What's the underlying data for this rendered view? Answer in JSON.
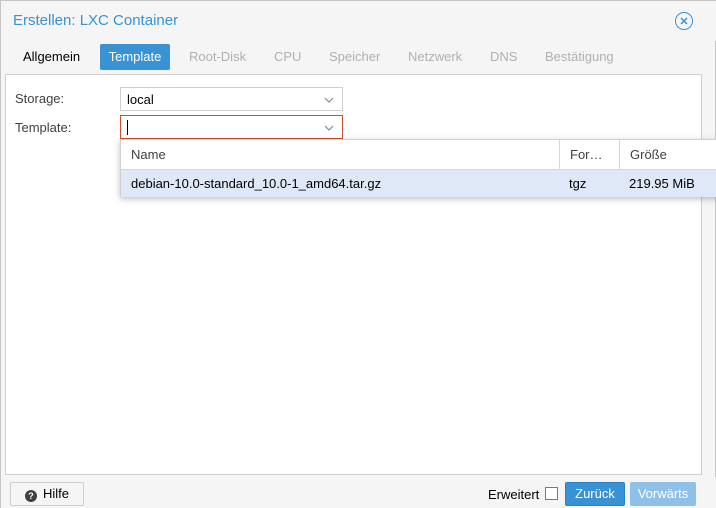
{
  "window": {
    "title": "Erstellen: LXC Container"
  },
  "tabs": [
    {
      "label": "Allgemein",
      "state": "done"
    },
    {
      "label": "Template",
      "state": "active"
    },
    {
      "label": "Root-Disk",
      "state": "disabled"
    },
    {
      "label": "CPU",
      "state": "disabled"
    },
    {
      "label": "Speicher",
      "state": "disabled"
    },
    {
      "label": "Netzwerk",
      "state": "disabled"
    },
    {
      "label": "DNS",
      "state": "disabled"
    },
    {
      "label": "Bestätigung",
      "state": "disabled"
    }
  ],
  "form": {
    "storage_label": "Storage:",
    "storage_value": "local",
    "template_label": "Template:",
    "template_value": ""
  },
  "dropdown": {
    "columns": [
      "Name",
      "For…",
      "Größe"
    ],
    "rows": [
      {
        "name": "debian-10.0-standard_10.0-1_amd64.tar.gz",
        "format": "tgz",
        "size": "219.95 MiB"
      }
    ]
  },
  "footer": {
    "help_label": "Hilfe",
    "advanced_label": "Erweitert",
    "advanced_checked": false,
    "back_label": "Zurück",
    "next_label": "Vorwärts"
  },
  "colors": {
    "accent": "#3892d4",
    "invalid_border": "#cf4c35",
    "selected_row": "#dfe8f6",
    "disabled_button": "#8fc1e8"
  }
}
